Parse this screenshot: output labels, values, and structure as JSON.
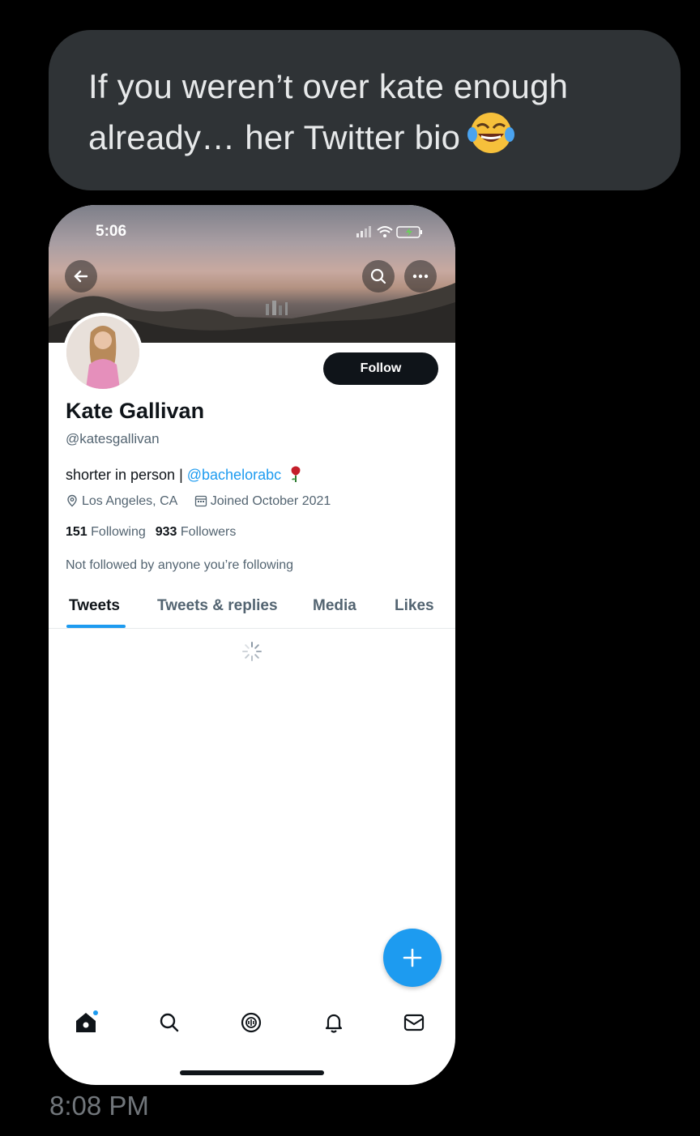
{
  "message": {
    "line1": "If you weren’t over kate enough",
    "line2": "already… her Twitter bio",
    "emoji": "face-with-tears-of-joy",
    "timestamp": "8:08 PM"
  },
  "phone": {
    "status_time": "5:06",
    "profile": {
      "name": "Kate Gallivan",
      "handle": "@katesgallivan",
      "bio_text": "shorter in person | ",
      "bio_link": "@bachelorabc",
      "bio_emoji": "rose",
      "location": "Los Angeles, CA",
      "joined": "Joined October 2021",
      "following_count": "151",
      "following_label": "Following",
      "followers_count": "933",
      "followers_label": "Followers",
      "not_followed": "Not followed by anyone you’re following",
      "follow_label": "Follow"
    },
    "tabs": [
      "Tweets",
      "Tweets & replies",
      "Media",
      "Likes"
    ],
    "active_tab": "Tweets",
    "bottom_nav": [
      "home-icon",
      "search-icon",
      "spaces-icon",
      "notifications-icon",
      "messages-icon"
    ],
    "accent_color": "#1d9bf0"
  }
}
